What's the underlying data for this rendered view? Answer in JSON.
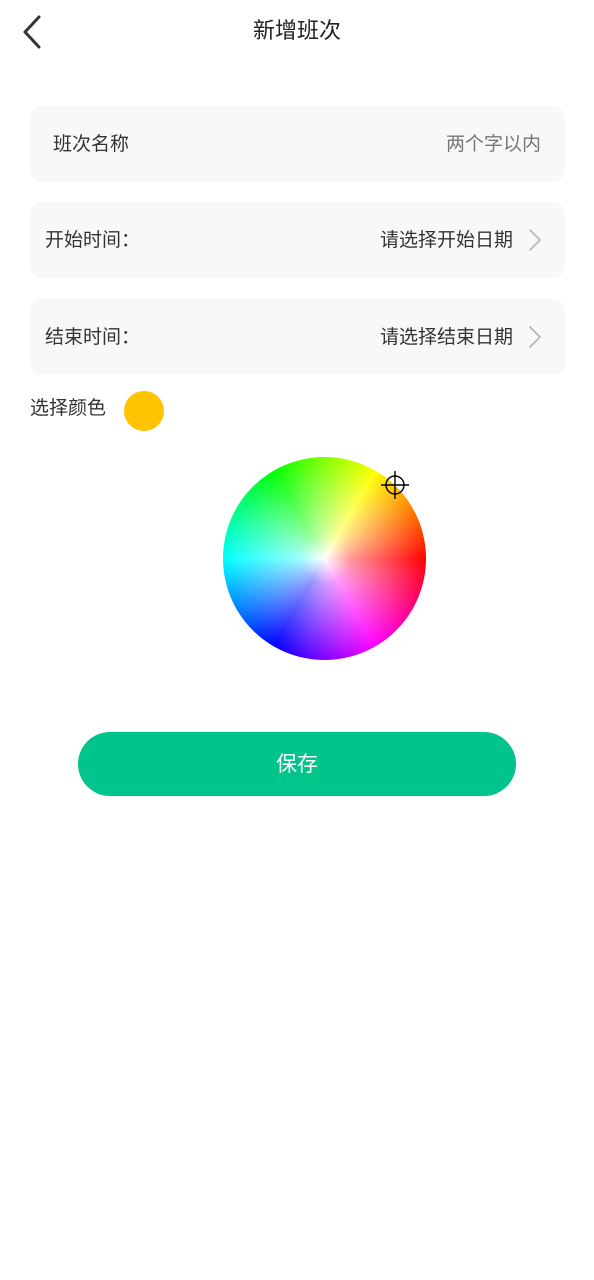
{
  "header": {
    "title": "新增班次",
    "back_icon": "chevron-left-icon"
  },
  "form": {
    "name": {
      "label": "班次名称",
      "value": "",
      "placeholder": "两个字以内"
    },
    "start_time": {
      "label": "开始时间：",
      "placeholder": "请选择开始日期",
      "icon": "chevron-right-icon"
    },
    "end_time": {
      "label": "结束时间：",
      "placeholder": "请选择结束日期",
      "icon": "chevron-right-icon"
    },
    "color": {
      "label": "选择颜色",
      "selected": "#ffc300"
    }
  },
  "actions": {
    "save_label": "保存"
  },
  "colors": {
    "accent": "#00c48c",
    "card_bg": "#f8f8f8",
    "text": "#333333",
    "placeholder": "#777777",
    "chevron": "#b5b5b5"
  }
}
